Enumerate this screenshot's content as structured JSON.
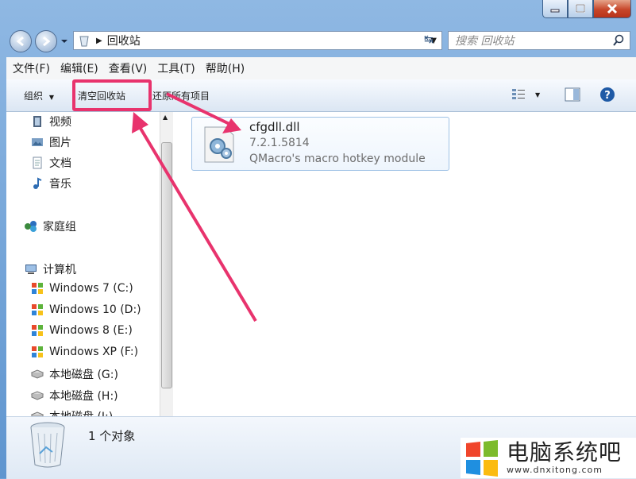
{
  "window": {
    "title_crumb": "回收站",
    "search_placeholder": "搜索 回收站"
  },
  "menubar": [
    "文件(F)",
    "编辑(E)",
    "查看(V)",
    "工具(T)",
    "帮助(H)"
  ],
  "toolbar": {
    "organize": "组织",
    "empty_bin": "清空回收站",
    "restore_all": "还原所有项目"
  },
  "nav": {
    "libraries": [
      "视频",
      "图片",
      "文档",
      "音乐"
    ],
    "homegroup": "家庭组",
    "computer": "计算机",
    "drives": [
      "Windows 7 (C:)",
      "Windows 10 (D:)",
      "Windows 8 (E:)",
      "Windows XP (F:)",
      "本地磁盘 (G:)",
      "本地磁盘 (H:)",
      "本地磁盘 (I:)"
    ]
  },
  "file": {
    "name": "cfgdll.dll",
    "version": "7.2.1.5814",
    "description": "QMacro's macro hotkey module"
  },
  "status": {
    "count": "1 个对象"
  },
  "watermark": {
    "text": "电脑系统吧",
    "url": "www.dnxitong.com"
  },
  "colors": {
    "arrow": "#e8336d",
    "frame": "#6ea3d8"
  }
}
